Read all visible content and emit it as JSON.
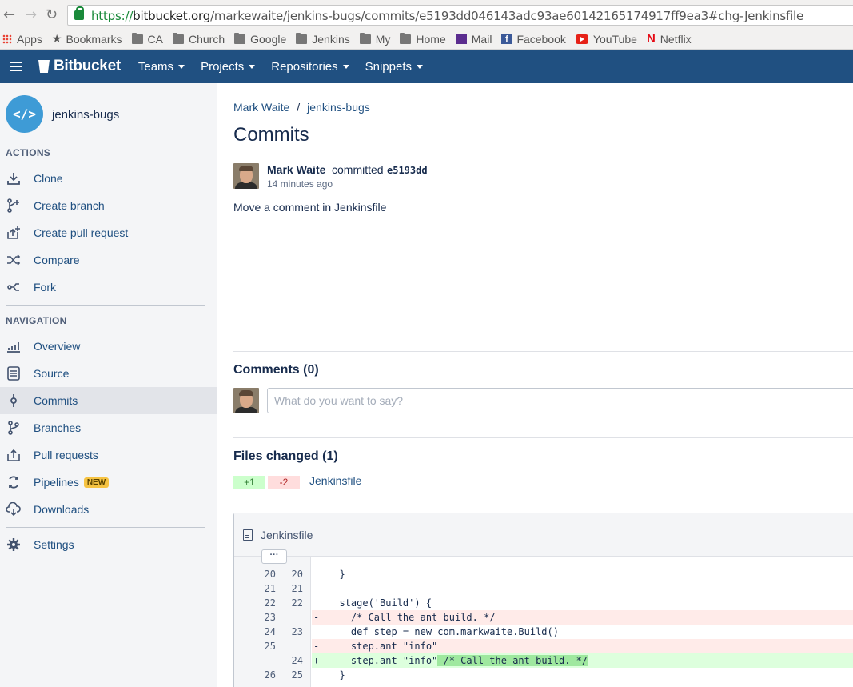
{
  "browser": {
    "url_protocol": "https://",
    "url_host": "bitbucket.org",
    "url_path": "/markewaite/jenkins-bugs/commits/e5193dd046143adc93ae60142165174917ff9ea3#chg-Jenkinsfile",
    "bookmarks": [
      {
        "label": "Apps",
        "icon": "apps-icon"
      },
      {
        "label": "Bookmarks",
        "icon": "star-icon"
      },
      {
        "label": "CA",
        "icon": "folder-icon"
      },
      {
        "label": "Church",
        "icon": "folder-icon"
      },
      {
        "label": "Google",
        "icon": "folder-icon"
      },
      {
        "label": "Jenkins",
        "icon": "folder-icon"
      },
      {
        "label": "My",
        "icon": "folder-icon"
      },
      {
        "label": "Home",
        "icon": "folder-icon"
      },
      {
        "label": "Mail",
        "icon": "mail-icon"
      },
      {
        "label": "Facebook",
        "icon": "facebook-icon"
      },
      {
        "label": "YouTube",
        "icon": "youtube-icon"
      },
      {
        "label": "Netflix",
        "icon": "netflix-icon"
      }
    ]
  },
  "header": {
    "logo": "Bitbucket",
    "menu": [
      "Teams",
      "Projects",
      "Repositories",
      "Snippets"
    ],
    "color": "#205081"
  },
  "sidebar": {
    "repo_avatar": "</>",
    "repo_name": "jenkins-bugs",
    "actions_heading": "ACTIONS",
    "actions": [
      {
        "label": "Clone",
        "icon": "download-icon"
      },
      {
        "label": "Create branch",
        "icon": "branch-add-icon"
      },
      {
        "label": "Create pull request",
        "icon": "pull-request-add-icon"
      },
      {
        "label": "Compare",
        "icon": "shuffle-icon"
      },
      {
        "label": "Fork",
        "icon": "fork-icon"
      }
    ],
    "navigation_heading": "NAVIGATION",
    "navigation": [
      {
        "label": "Overview",
        "icon": "chart-icon"
      },
      {
        "label": "Source",
        "icon": "document-icon"
      },
      {
        "label": "Commits",
        "icon": "commit-icon",
        "active": true
      },
      {
        "label": "Branches",
        "icon": "branch-icon"
      },
      {
        "label": "Pull requests",
        "icon": "pull-request-icon"
      },
      {
        "label": "Pipelines",
        "icon": "pipelines-icon",
        "badge": "NEW"
      },
      {
        "label": "Downloads",
        "icon": "cloud-download-icon"
      }
    ],
    "settings": {
      "label": "Settings",
      "icon": "gear-icon"
    }
  },
  "main": {
    "breadcrumb": {
      "owner": "Mark Waite",
      "separator": "/",
      "repo": "jenkins-bugs"
    },
    "title": "Commits",
    "commit": {
      "author": "Mark Waite",
      "verb": "committed",
      "hash": "e5193dd",
      "time": "14 minutes ago",
      "message": "Move a comment in Jenkinsfile"
    },
    "comments": {
      "title": "Comments (0)",
      "placeholder": "What do you want to say?"
    },
    "files_changed": {
      "title": "Files changed (1)",
      "added": "+1",
      "removed": "-2",
      "file": "Jenkinsfile"
    },
    "diff": {
      "filename": "Jenkinsfile",
      "expand": "···",
      "lines": [
        {
          "old": "20",
          "new": "20",
          "type": "context",
          "marker": "",
          "code": "  }"
        },
        {
          "old": "21",
          "new": "21",
          "type": "context",
          "marker": "",
          "code": ""
        },
        {
          "old": "22",
          "new": "22",
          "type": "context",
          "marker": "",
          "code": "  stage('Build') {"
        },
        {
          "old": "23",
          "new": "",
          "type": "removed",
          "marker": "-",
          "code": "    /* Call the ant build. */"
        },
        {
          "old": "24",
          "new": "23",
          "type": "context",
          "marker": "",
          "code": "    def step = new com.markwaite.Build()"
        },
        {
          "old": "25",
          "new": "",
          "type": "removed",
          "marker": "-",
          "code": "    step.ant \"info\""
        },
        {
          "old": "",
          "new": "24",
          "type": "added",
          "marker": "+",
          "code": "    step.ant \"info\"",
          "code_highlight": " /* Call the ant build. */"
        },
        {
          "old": "26",
          "new": "25",
          "type": "context",
          "marker": "",
          "code": "  }"
        }
      ]
    }
  }
}
